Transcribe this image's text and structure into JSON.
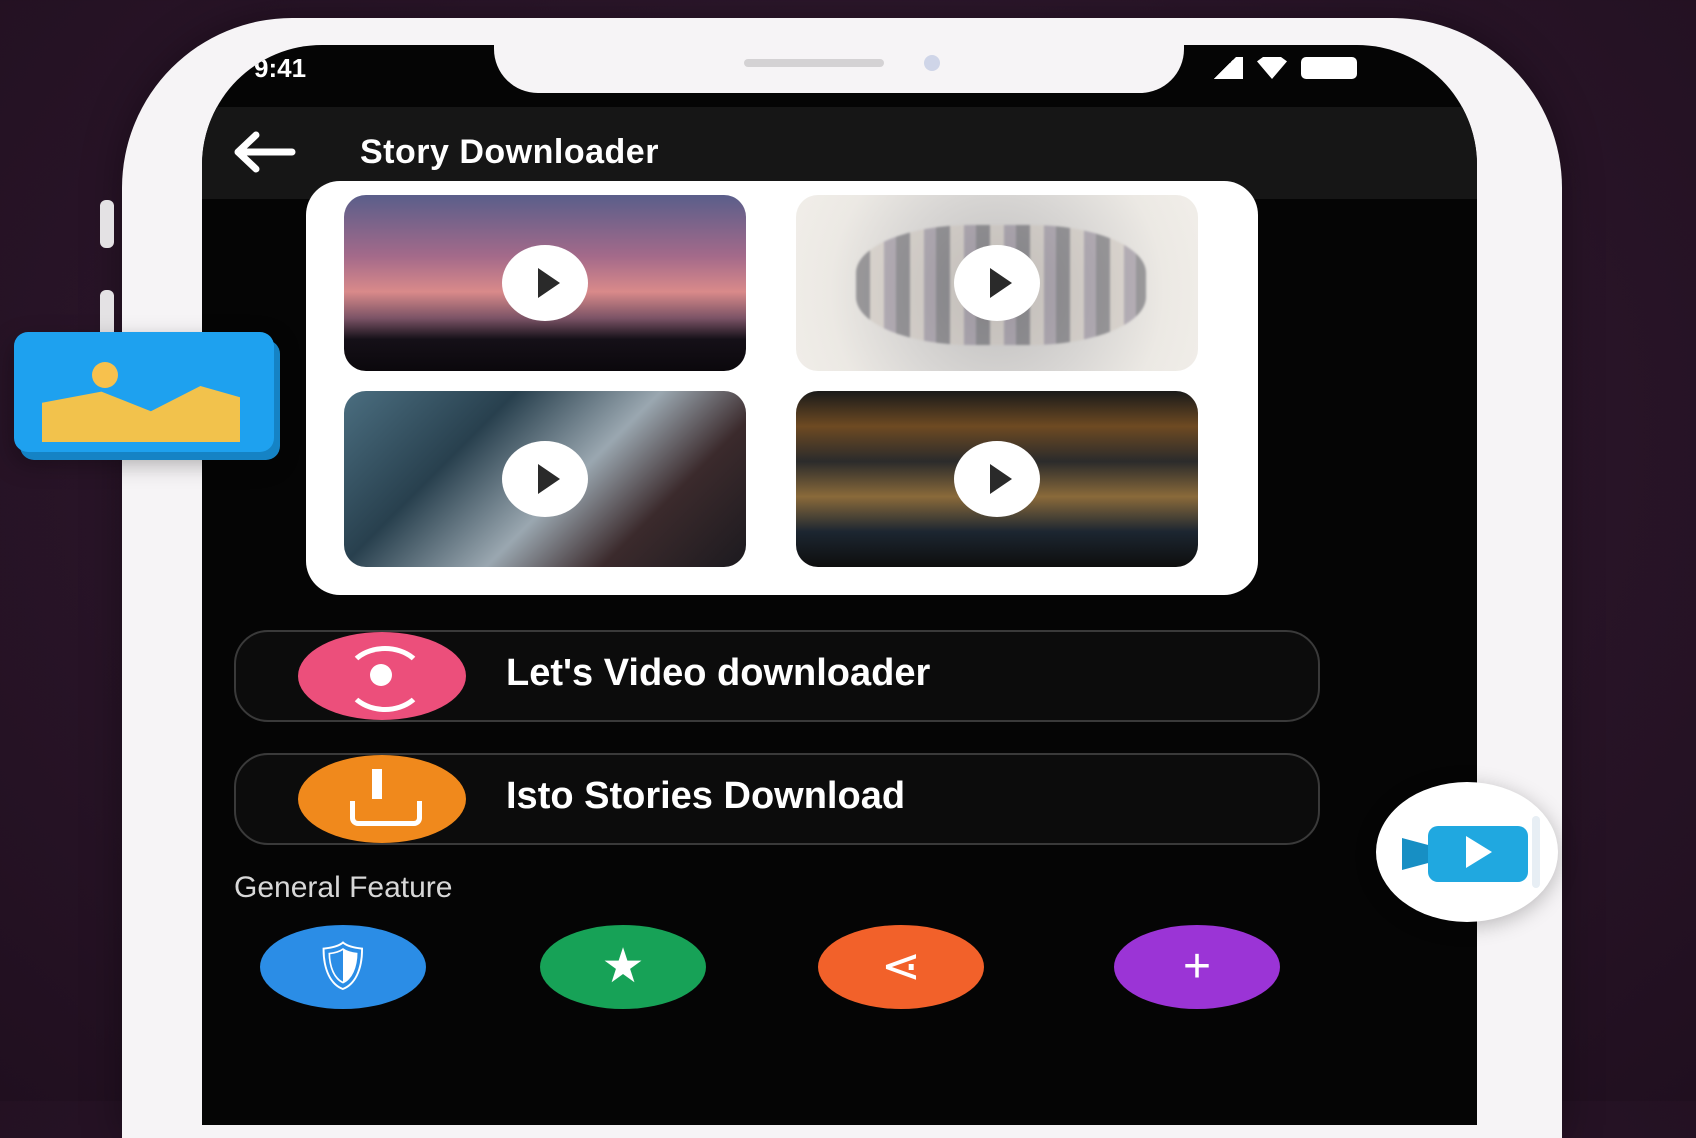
{
  "status_bar": {
    "time": "9:41"
  },
  "app_bar": {
    "title": "Story Downloader",
    "back_icon": "arrow-left-icon"
  },
  "gallery": {
    "thumbnails": [
      {
        "name": "sunset-thumbnail",
        "icon": "play-icon"
      },
      {
        "name": "collage-thumbnail",
        "icon": "play-icon"
      },
      {
        "name": "street-thumbnail",
        "icon": "play-icon"
      },
      {
        "name": "city-night-thumbnail",
        "icon": "play-icon"
      }
    ]
  },
  "actions": [
    {
      "label": "Let's Video downloader",
      "icon": "video-download-icon",
      "color": "#ec4f7b"
    },
    {
      "label": "Isto Stories Download",
      "icon": "download-tray-icon",
      "color": "#f0891c"
    }
  ],
  "general_feature": {
    "title": "General Feature",
    "items": [
      {
        "icon": "shield-info-icon",
        "color": "#2b8de6",
        "glyph": "🛡",
        "label": ""
      },
      {
        "icon": "star-icon",
        "color": "#17a257",
        "glyph": "★",
        "label": ""
      },
      {
        "icon": "share-icon",
        "color": "#f2612a",
        "glyph": "⋖",
        "label": ""
      },
      {
        "icon": "plus-icon",
        "color": "#9b34d6",
        "glyph": "+",
        "label": ""
      }
    ]
  },
  "decorations": {
    "left_icon": "gallery-image-icon",
    "right_icon": "video-camera-icon"
  }
}
